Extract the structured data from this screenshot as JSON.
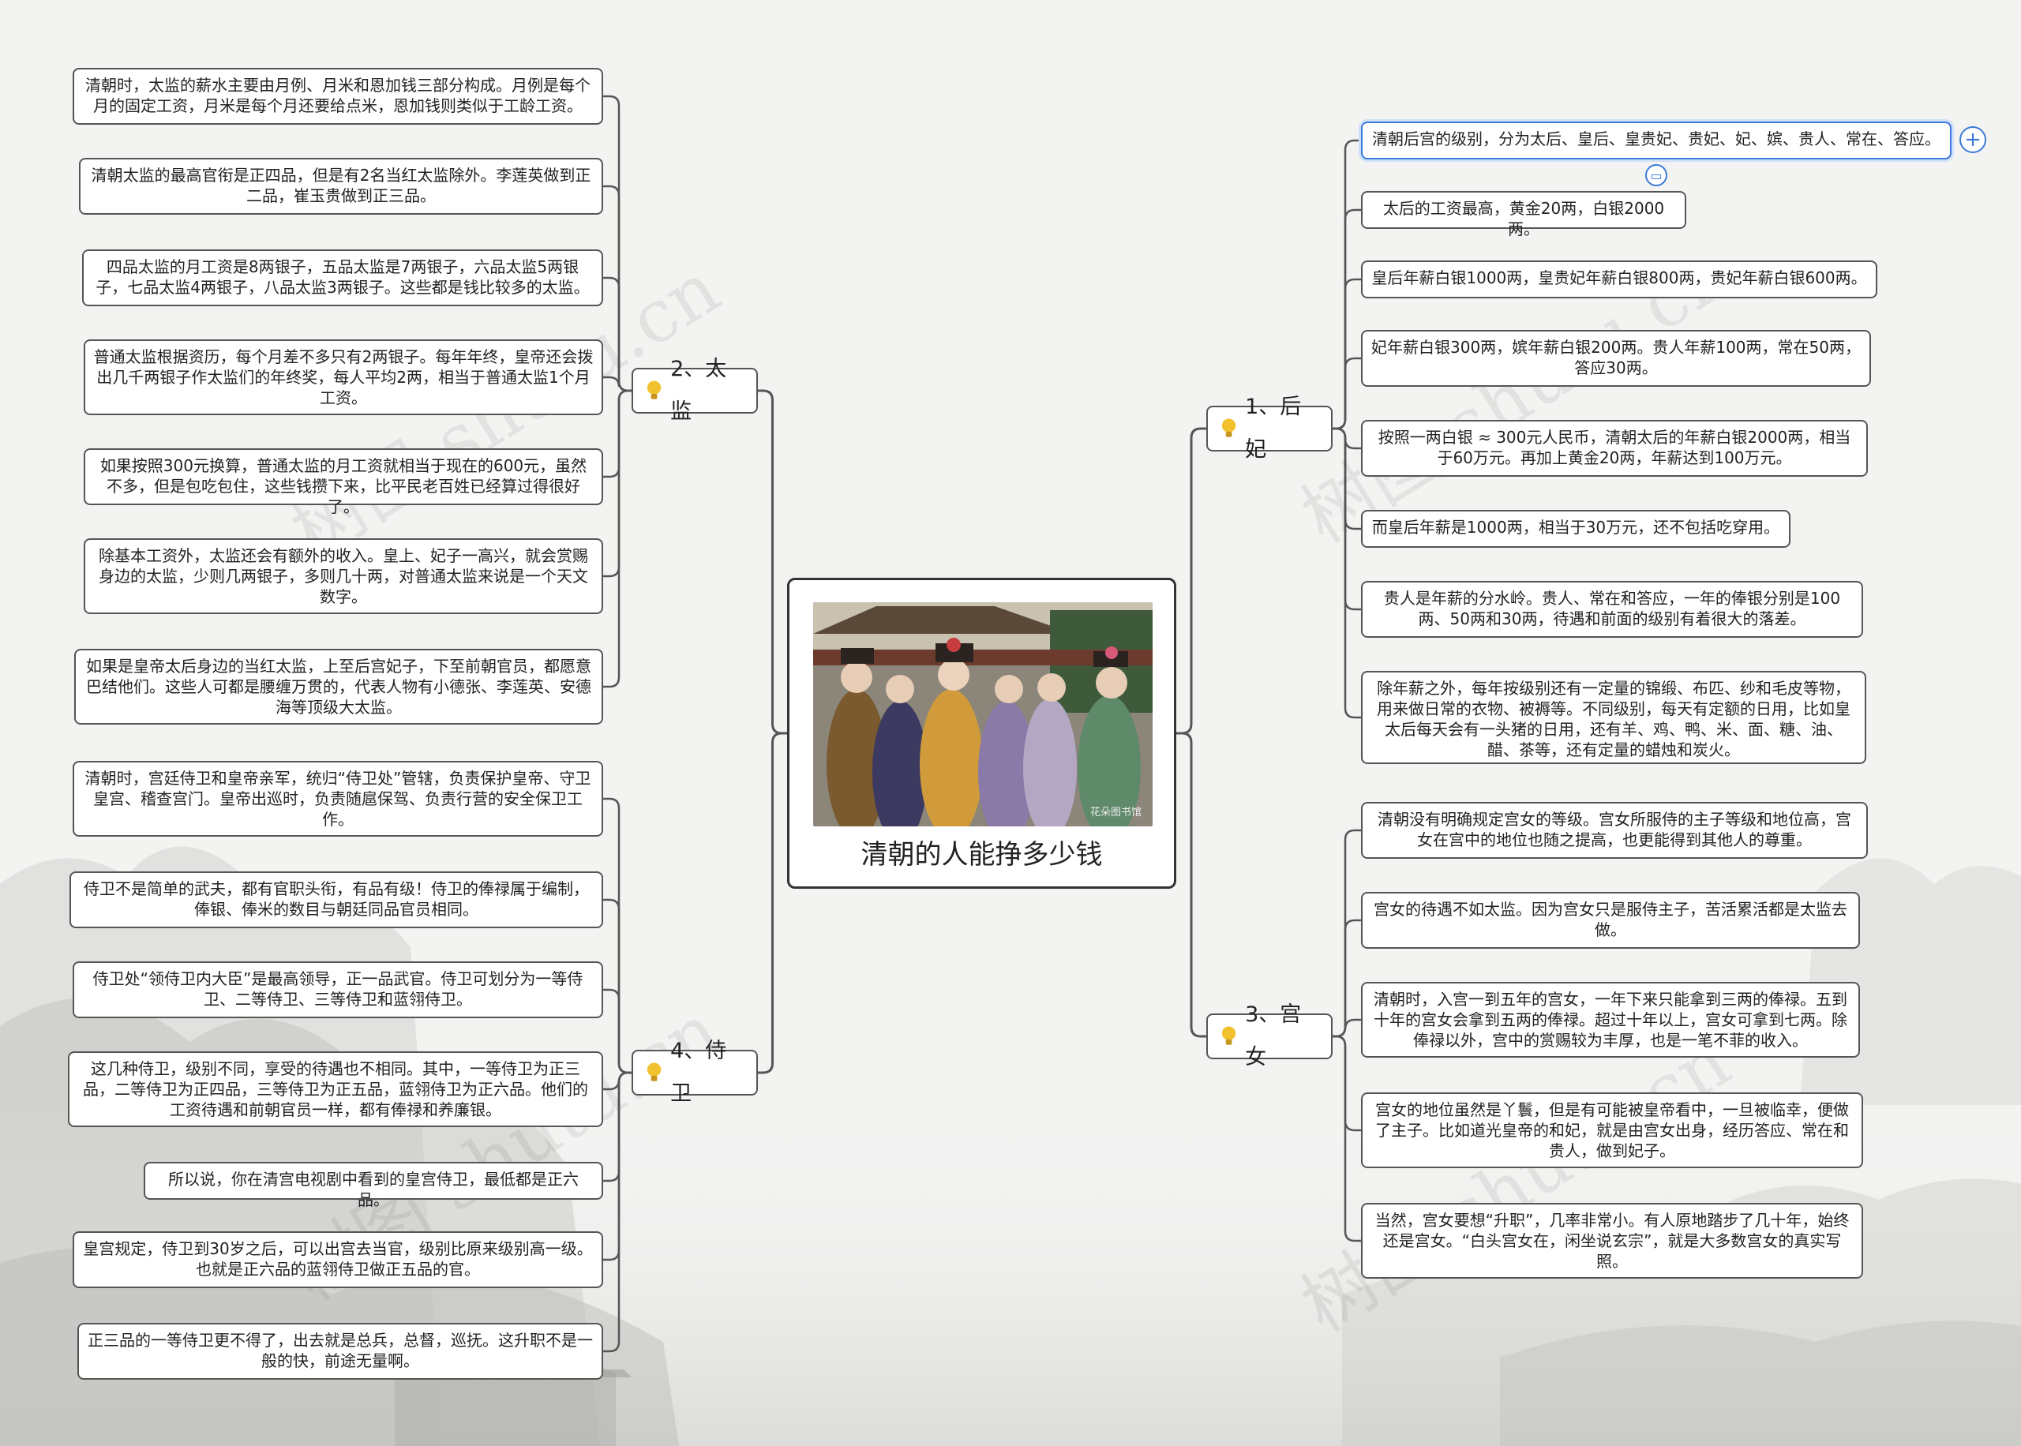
{
  "center": {
    "title": "清朝的人能挣多少钱",
    "photo_caption": "花朵图书馆"
  },
  "branches": {
    "eunuch": {
      "label": "2、太监",
      "items": [
        "清朝时，太监的薪水主要由月例、月米和恩加钱三部分构成。月例是每个月的固定工资，月米是每个月还要给点米，恩加钱则类似于工龄工资。",
        "清朝太监的最高官衔是正四品，但是有2名当红太监除外。李莲英做到正二品，崔玉贵做到正三品。",
        "四品太监的月工资是8两银子，五品太监是7两银子，六品太监5两银子，七品太监4两银子，八品太监3两银子。这些都是钱比较多的太监。",
        "普通太监根据资历，每个月差不多只有2两银子。每年年终，皇帝还会拨出几千两银子作太监们的年终奖，每人平均2两，相当于普通太监1个月工资。",
        "如果按照300元换算，普通太监的月工资就相当于现在的600元，虽然不多，但是包吃包住，这些钱攒下来，比平民老百姓已经算过得很好了。",
        "除基本工资外，太监还会有额外的收入。皇上、妃子一高兴，就会赏赐身边的太监，少则几两银子，多则几十两，对普通太监来说是一个天文数字。",
        "如果是皇帝太后身边的当红太监，上至后宫妃子，下至前朝官员，都愿意巴结他们。这些人可都是腰缠万贯的，代表人物有小德张、李莲英、安德海等顶级大太监。"
      ]
    },
    "guard": {
      "label": "4、侍卫",
      "items": [
        "清朝时，宫廷侍卫和皇帝亲军，统归“侍卫处”管辖，负责保护皇帝、守卫皇宫、稽查宫门。皇帝出巡时，负责随扈保驾、负责行营的安全保卫工作。",
        "侍卫不是简单的武夫，都有官职头衔，有品有级！侍卫的俸禄属于编制，俸银、俸米的数目与朝廷同品官员相同。",
        "侍卫处“领侍卫内大臣”是最高领导，正一品武官。侍卫可划分为一等侍卫、二等侍卫、三等侍卫和蓝翎侍卫。",
        "这几种侍卫，级别不同，享受的待遇也不相同。其中，一等侍卫为正三品，二等侍卫为正四品，三等侍卫为正五品，蓝翎侍卫为正六品。他们的工资待遇和前朝官员一样，都有俸禄和养廉银。",
        "所以说，你在清宫电视剧中看到的皇宫侍卫，最低都是正六品。",
        "皇宫规定，侍卫到30岁之后，可以出宫去当官，级别比原来级别高一级。也就是正六品的蓝翎侍卫做正五品的官。",
        "正三品的一等侍卫更不得了，出去就是总兵，总督，巡抚。这升职不是一般的快，前途无量啊。"
      ]
    },
    "consort": {
      "label": "1、后妃",
      "items": [
        "清朝后宫的级别，分为太后、皇后、皇贵妃、贵妃、妃、嫔、贵人、常在、答应。",
        "太后的工资最高，黄金20两，白银2000两。",
        "皇后年薪白银1000两，皇贵妃年薪白银800两，贵妃年薪白银600两。",
        "妃年薪白银300两，嫔年薪白银200两。贵人年薪100两，常在50两，答应30两。",
        "按照一两白银 ≈ 300元人民币，清朝太后的年薪白银2000两，相当于60万元。再加上黄金20两，年薪达到100万元。",
        "而皇后年薪是1000两，相当于30万元，还不包括吃穿用。",
        "贵人是年薪的分水岭。贵人、常在和答应，一年的俸银分别是100两、50两和30两，待遇和前面的级别有着很大的落差。",
        "除年薪之外，每年按级别还有一定量的锦缎、布匹、纱和毛皮等物，用来做日常的衣物、被褥等。不同级别，每天有定额的日用，比如皇太后每天会有一头猪的日用，还有羊、鸡、鸭、米、面、糖、油、醋、茶等，还有定量的蜡烛和炭火。"
      ]
    },
    "maid": {
      "label": "3、宫女",
      "items": [
        "清朝没有明确规定宫女的等级。宫女所服侍的主子等级和地位高，宫女在宫中的地位也随之提高，也更能得到其他人的尊重。",
        "宫女的待遇不如太监。因为宫女只是服侍主子，苦活累活都是太监去做。",
        "清朝时，入宫一到五年的宫女，一年下来只能拿到三两的俸禄。五到十年的宫女会拿到五两的俸禄。超过十年以上，宫女可拿到七两。除俸禄以外，宫中的赏赐较为丰厚，也是一笔不菲的收入。",
        "宫女的地位虽然是丫鬟，但是有可能被皇帝看中，一旦被临幸，便做了主子。比如道光皇帝的和妃，就是由宫女出身，经历答应、常在和贵人，做到妃子。",
        "当然，宫女要想“升职”，几率非常小。有人原地踏步了几十年，始终还是宫女。“白头宫女在，闲坐说玄宗”，就是大多数宫女的真实写照。"
      ]
    }
  },
  "watermarks": [
    "树图 shutu.cn",
    "树图 shutu.cn",
    "树图 shutu.cn",
    "树图 shutu.cn"
  ],
  "icons": {
    "bulb": "lightbulb-icon",
    "add": "add-circle-icon",
    "collapse": "collapse-icon"
  },
  "colors": {
    "line": "#555555",
    "accent": "#3d7bd9",
    "bulb": "#f2c12e"
  }
}
